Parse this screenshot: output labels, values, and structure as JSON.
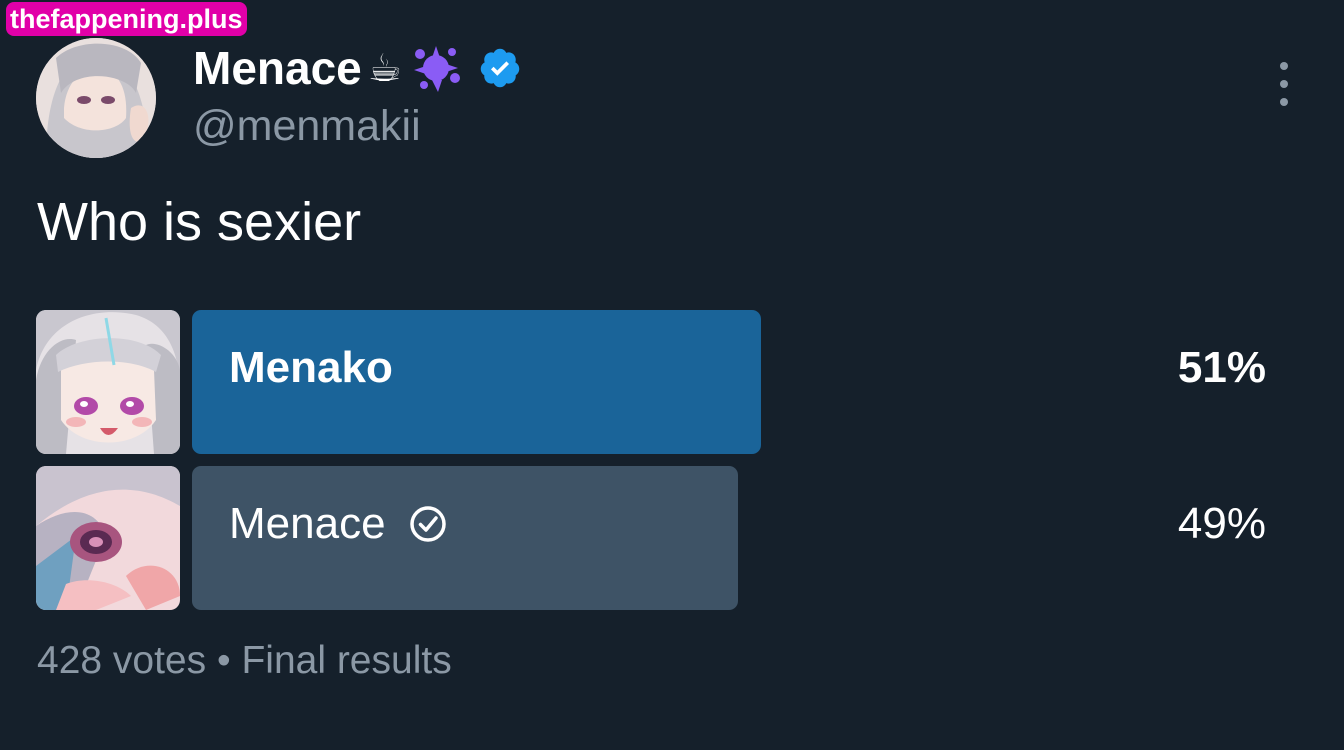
{
  "watermark": "thefappening.plus",
  "author": {
    "display_name": "Menace",
    "name_emojis": "☕",
    "emoji_icons": [
      "coffee-cup-icon",
      "purple-splat-icon"
    ],
    "verified_icon": "verified-badge-icon",
    "handle": "@menmakii",
    "avatar": "avatar"
  },
  "tweet": {
    "text": "Who is sexier"
  },
  "poll": {
    "options": [
      {
        "label": "Menako",
        "percent_text": "51%",
        "share": 0.51,
        "winner": true,
        "thumbnail": "anime-girl-thumbnail"
      },
      {
        "label": "Menace",
        "percent_text": "49%",
        "share": 0.49,
        "winner": false,
        "voted": true,
        "thumbnail": "anime-girl-closeup-thumbnail"
      }
    ],
    "winner_bar_color": "#1a6499",
    "loser_bar_color": "#3e5366"
  },
  "footer": {
    "votes": "428 votes",
    "separator": " • ",
    "status": "Final results"
  },
  "colors": {
    "background": "#15202b",
    "secondary_text": "#8b98a5",
    "verified_blue": "#1d9bf0",
    "watermark_bg": "#e100a8"
  },
  "more_icon": "more-vertical-icon"
}
